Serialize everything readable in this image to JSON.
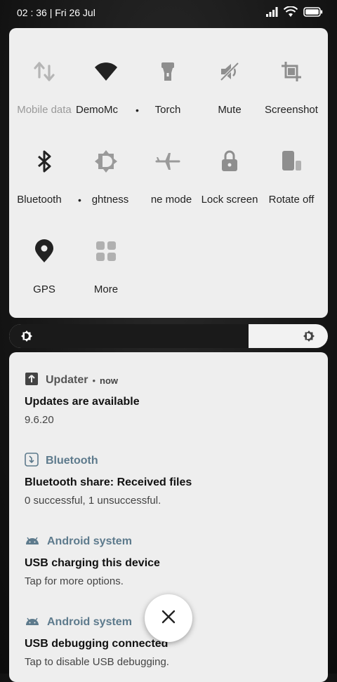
{
  "status_bar": {
    "time_date": "02 : 36 | Fri 26 Jul"
  },
  "quick_settings": {
    "tiles": [
      {
        "label": "Mobile data",
        "icon": "mobile-data-icon",
        "active": false
      },
      {
        "label": "DemoMc",
        "icon": "wifi-icon",
        "active": true
      },
      {
        "label": "Torch",
        "icon": "torch-icon",
        "active": false
      },
      {
        "label": "Mute",
        "icon": "mute-icon",
        "active": false
      },
      {
        "label": "Screenshot",
        "icon": "screenshot-icon",
        "active": false
      },
      {
        "label": "Bluetooth",
        "icon": "bluetooth-icon",
        "active": true
      },
      {
        "label": "ghtness",
        "icon": "auto-brightness-icon",
        "active": false
      },
      {
        "label": "ne mode",
        "icon": "airplane-icon",
        "active": false
      },
      {
        "label": "Lock screen",
        "icon": "lock-icon",
        "active": false
      },
      {
        "label": "Rotate off",
        "icon": "rotate-icon",
        "active": false
      },
      {
        "label": "GPS",
        "icon": "location-icon",
        "active": true
      },
      {
        "label": "More",
        "icon": "more-grid-icon",
        "active": false
      }
    ]
  },
  "brightness": {
    "level": 0.75
  },
  "notifications": [
    {
      "app": "Updater",
      "time": "now",
      "title": "Updates are available",
      "text": "9.6.20",
      "icon": "updater-icon"
    },
    {
      "app": "Bluetooth",
      "time": "",
      "title": "Bluetooth share: Received files",
      "text": "0 successful, 1 unsuccessful.",
      "icon": "bluetooth-share-icon"
    },
    {
      "app": "Android system",
      "time": "",
      "title": "USB charging this device",
      "text": "Tap for more options.",
      "icon": "android-icon"
    },
    {
      "app": "Android system",
      "time": "",
      "title": "USB debugging connected",
      "text": "Tap to disable USB debugging.",
      "icon": "android-icon"
    }
  ],
  "colors": {
    "accent_blue": "#5d7a8c",
    "panel": "#eeeeee",
    "active_icon": "#222222",
    "inactive_icon": "#9e9e9e"
  }
}
